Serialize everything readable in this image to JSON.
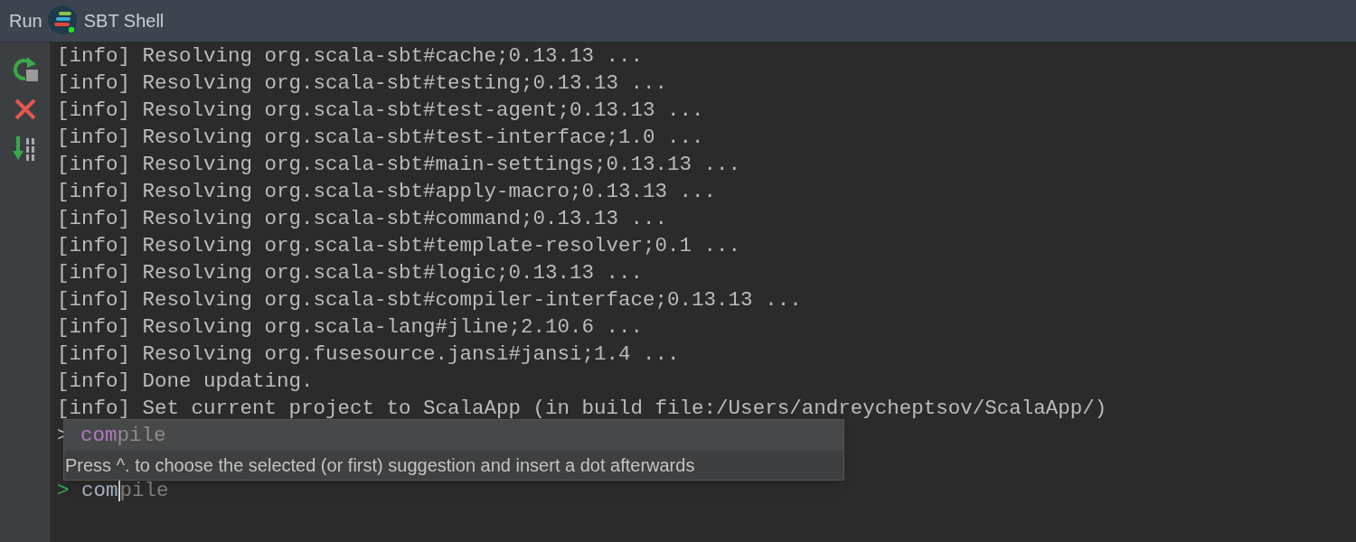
{
  "header": {
    "label": "Run",
    "title": "SBT Shell"
  },
  "log_lines": [
    "[info] Resolving org.scala-sbt#cache;0.13.13 ...",
    "[info] Resolving org.scala-sbt#testing;0.13.13 ...",
    "[info] Resolving org.scala-sbt#test-agent;0.13.13 ...",
    "[info] Resolving org.scala-sbt#test-interface;1.0 ...",
    "[info] Resolving org.scala-sbt#main-settings;0.13.13 ...",
    "[info] Resolving org.scala-sbt#apply-macro;0.13.13 ...",
    "[info] Resolving org.scala-sbt#command;0.13.13 ...",
    "[info] Resolving org.scala-sbt#template-resolver;0.1 ...",
    "[info] Resolving org.scala-sbt#logic;0.13.13 ...",
    "[info] Resolving org.scala-sbt#compiler-interface;0.13.13 ...",
    "[info] Resolving org.scala-lang#jline;2.10.6 ...",
    "[info] Resolving org.fusesource.jansi#jansi;1.4 ...",
    "[info] Done updating.",
    "[info] Set current project to ScalaApp (in build file:/Users/andreycheptsov/ScalaApp/)"
  ],
  "covered_prompt": ">",
  "popup": {
    "match": "com",
    "rest": "pile",
    "hint": "Press ^. to choose the selected (or first) suggestion and insert a dot afterwards"
  },
  "input": {
    "prompt": ">",
    "typed": "com",
    "completion": "pile"
  }
}
